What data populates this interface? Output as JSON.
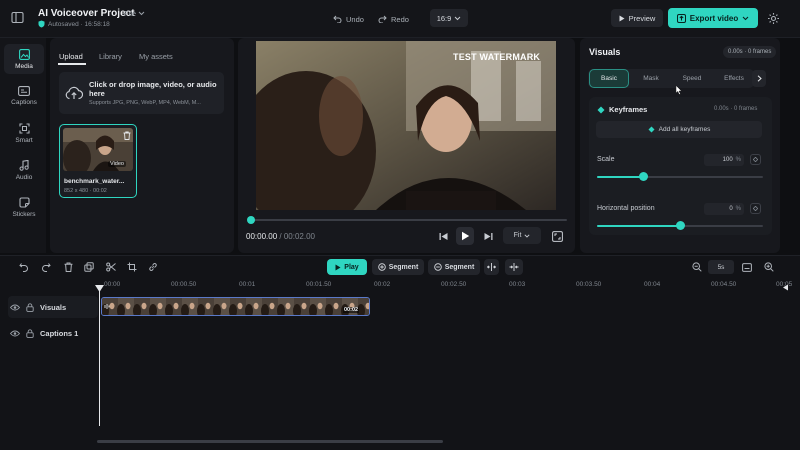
{
  "app": {
    "project_title": "AI Voiceover Project",
    "file_menu": "File",
    "autosave_status": "Autosaved · 16:58:18"
  },
  "toolbar": {
    "undo_label": "Undo",
    "redo_label": "Redo",
    "aspect_ratio": "16:9",
    "preview_label": "Preview",
    "export_label": "Export video"
  },
  "rail": {
    "items": [
      {
        "label": "Media",
        "icon": "media-icon",
        "active": true
      },
      {
        "label": "Captions",
        "icon": "captions-icon",
        "active": false
      },
      {
        "label": "Smart",
        "icon": "smart-icon",
        "active": false
      },
      {
        "label": "Audio",
        "icon": "audio-icon",
        "active": false
      },
      {
        "label": "Stickers",
        "icon": "stickers-icon",
        "active": false
      }
    ]
  },
  "media": {
    "tabs": [
      "Upload",
      "Library",
      "My assets"
    ],
    "active_tab": "Upload",
    "drop_title": "Click or drop image, video, or audio here",
    "drop_subtitle": "Supports JPG, PNG, WebP, MP4, WebM, M...",
    "file": {
      "name": "benchmark_water...",
      "badge": "Video",
      "meta": "852 x 480 · 00:02"
    }
  },
  "preview": {
    "watermark": "TEST WATERMARK",
    "current_time": "00:00.00",
    "total_time": "/ 00:02.00",
    "fit_label": "Fit",
    "progress": 0.0
  },
  "properties": {
    "title": "Visuals",
    "time_badge": "0.00s · 0 frames",
    "tabs": [
      "Basic",
      "Mask",
      "Speed",
      "Effects"
    ],
    "active_tab": "Basic",
    "keyframes_label": "Keyframes",
    "keyframes_meta": "0.00s · 0 frames",
    "add_keyframes_label": "Add all keyframes",
    "scale": {
      "label": "Scale",
      "value": "100",
      "unit": "%",
      "fraction": 0.28
    },
    "hpos": {
      "label": "Horizontal position",
      "value": "0",
      "unit": "%",
      "fraction": 0.5
    }
  },
  "timeline": {
    "play_label": "Play",
    "segment1_label": "Segment",
    "segment2_label": "Segment",
    "zoom_value": "5s",
    "ruler": [
      "00:00",
      "00:00.50",
      "00:01",
      "00:01.50",
      "00:02",
      "00:02.50",
      "00:03",
      "00:03.50",
      "00:04",
      "00:04.50",
      "00:05"
    ],
    "tracks": [
      {
        "name": "Visuals"
      },
      {
        "name": "Captions 1"
      }
    ],
    "clip_duration": "00:02"
  },
  "colors": {
    "accent": "#2fd6c1",
    "background": "#0e0f12",
    "panel": "#17181d",
    "clip_border": "#5a79c9"
  }
}
